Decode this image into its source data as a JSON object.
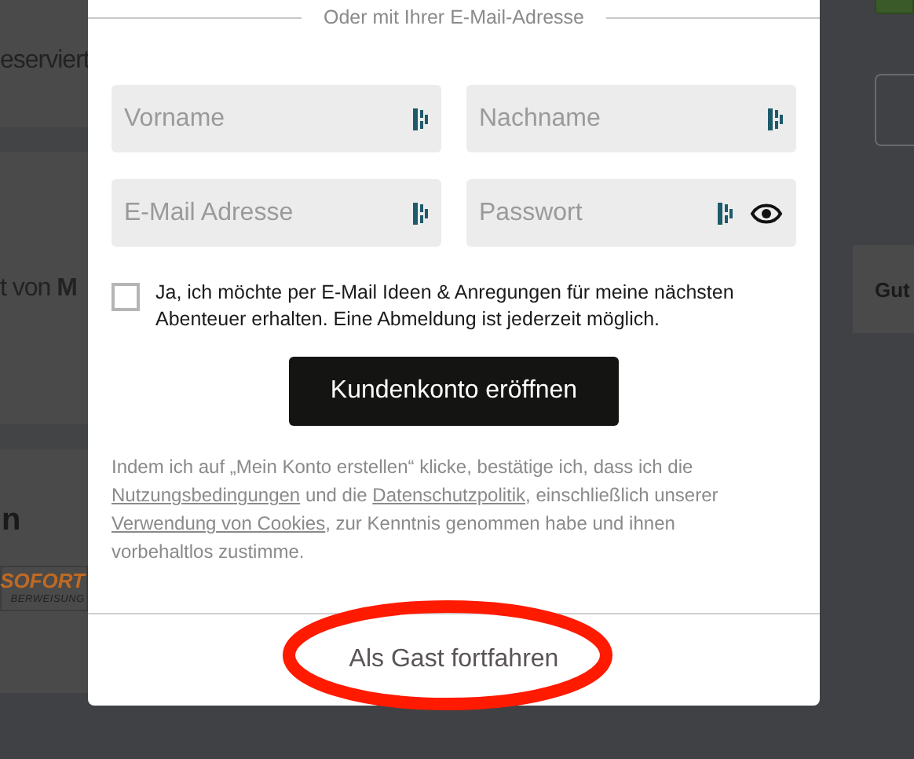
{
  "background": {
    "left_texts": [
      "eserviert",
      "t von **M**",
      "n"
    ],
    "payment_logo": [
      "SOFORT",
      "BERWEISUNG"
    ],
    "right_text": "Gut"
  },
  "modal": {
    "divider_label": "Oder mit Ihrer E-Mail-Adresse",
    "fields": [
      {
        "placeholder": "Vorname",
        "kind": "text"
      },
      {
        "placeholder": "Nachname",
        "kind": "text"
      },
      {
        "placeholder": "E-Mail Adresse",
        "kind": "text"
      },
      {
        "placeholder": "Passwort",
        "kind": "password"
      }
    ],
    "newsletter": {
      "label": "Ja, ich möchte per E-Mail Ideen & Anregungen für meine nächsten Abenteuer erhalten. Eine Abmeldung ist jederzeit möglich.",
      "checked": false
    },
    "submit": "Kundenkonto eröffnen",
    "legal": [
      {
        "kind": "text",
        "text": "Indem ich auf „Mein Konto erstellen“ klicke, bestätige ich, dass ich die "
      },
      {
        "kind": "link",
        "text": "Nutzungsbedingungen"
      },
      {
        "kind": "text",
        "text": " und die "
      },
      {
        "kind": "link",
        "text": "Datenschutzpolitik"
      },
      {
        "kind": "text",
        "text": ", einschließlich unserer "
      },
      {
        "kind": "link",
        "text": "Verwendung von Cookies"
      },
      {
        "kind": "text",
        "text": ", zur Kenntnis genommen habe und ihnen vorbehaltlos zustimme."
      }
    ],
    "guest_link": "Als Gast fortfahren"
  }
}
